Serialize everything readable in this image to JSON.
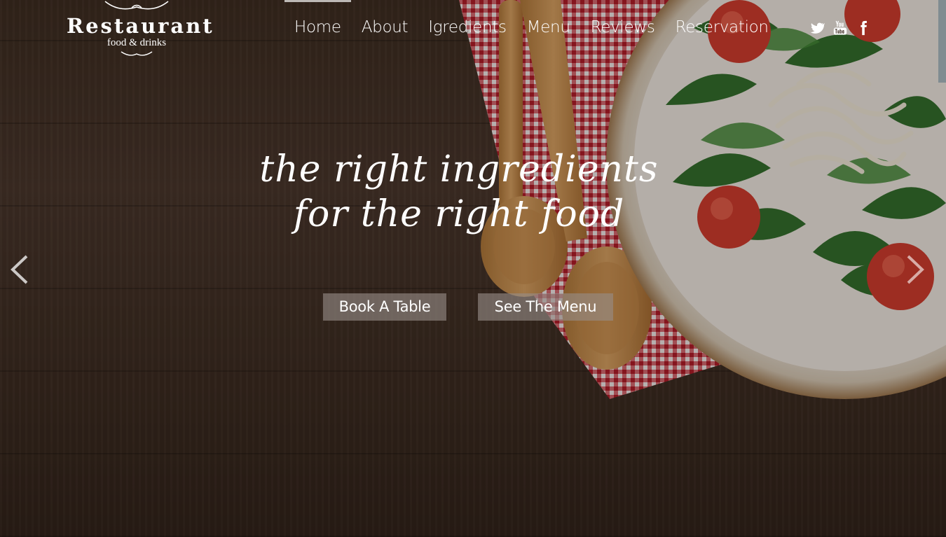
{
  "brand": {
    "name": "Restaurant",
    "tagline": "food & drinks"
  },
  "nav": {
    "items": [
      {
        "label": "Home",
        "active": true
      },
      {
        "label": "About"
      },
      {
        "label": "Igredients"
      },
      {
        "label": "Menu"
      },
      {
        "label": "Reviews"
      },
      {
        "label": "Reservation"
      }
    ]
  },
  "social": {
    "icons": [
      "twitter-icon",
      "youtube-icon",
      "facebook-icon"
    ]
  },
  "hero": {
    "headline_line1": "the right ingredients",
    "headline_line2": "for the right food",
    "book_label": "Book A Table",
    "menu_label": "See The Menu"
  },
  "colors": {
    "text": "#ffffff",
    "button_bg": "#968c87",
    "nav_active_bar": "#bdb9b6",
    "wood": "#3a2a1f",
    "napkin_red": "#c0202c"
  }
}
